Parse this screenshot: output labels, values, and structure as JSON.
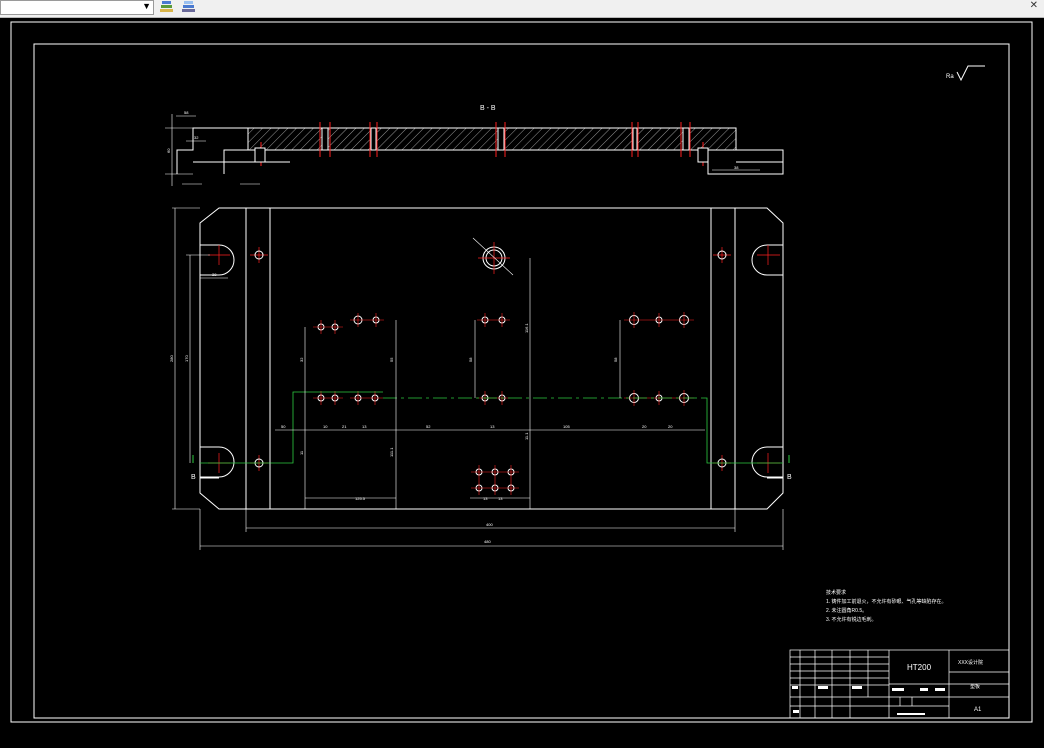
{
  "toolbar": {
    "layer_combo_value": "",
    "icons": [
      "layer-states-icon",
      "layer-stack-icon"
    ]
  },
  "drawing": {
    "section_label": "B - B",
    "marker_left": "B",
    "marker_right": "B",
    "roughness_symbol": "Ra",
    "dims": {
      "overall_width": "480",
      "inner_width": "400",
      "height_left": "280",
      "d170": "170",
      "d38": "38",
      "d32": "32",
      "d55": "55",
      "d58": "58",
      "d50": "50",
      "d60": "60",
      "d10": "10",
      "d21": "21",
      "d13": "13",
      "d52": "52",
      "d105": "105",
      "d20": "20",
      "d11": "11",
      "d125": "125.5",
      "d111": "111.1",
      "d116": "116.1",
      "d11b": "11.1"
    },
    "notes": [
      "技术要求",
      "1. 铸件加工前退火，不允许有砂眼、气孔等缺陷存在。",
      "2. 未注圆角R0.5。",
      "3. 不允许有锐边毛刺。"
    ],
    "title_block": {
      "material": "HT200",
      "project": "XXX设计院",
      "part_name": "垫板",
      "sheet": "A1"
    }
  }
}
